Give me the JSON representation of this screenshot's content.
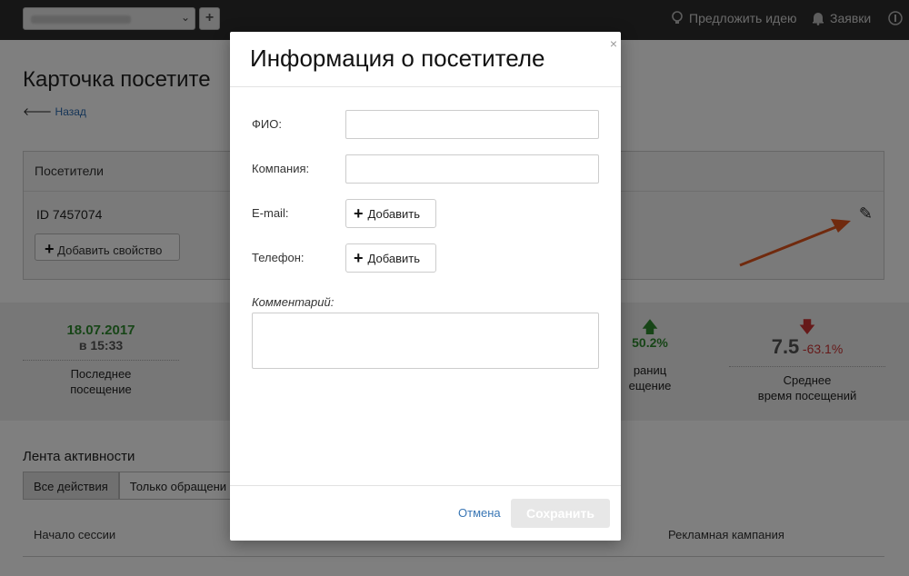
{
  "topbar": {
    "nav_idea": "Предложить идею",
    "nav_requests": "Заявки",
    "add_symbol": "+",
    "chevron": "⌄"
  },
  "page": {
    "title": "Карточка посетите",
    "back_label": "Назад"
  },
  "visitors": {
    "header": "Посетители",
    "id_label": "ID 7457074",
    "add_property_label": "Добавить свойство"
  },
  "stats": {
    "last_visit_date": "18.07.2017",
    "last_visit_time": "в 15:33",
    "last_visit_label": "Последнее\nпосещение",
    "pages_change": "50.2%",
    "pages_label_part1": "раниц",
    "pages_label_part2": "ещение",
    "avg_value": "7.5",
    "avg_change": "-63.1%",
    "avg_label": "Среднее\nвремя посещений",
    "colors": {
      "up": "#2e8b2e",
      "down": "#cc3333"
    }
  },
  "feed": {
    "title": "Лента активности",
    "tabs": [
      "Все действия",
      "Только обращени"
    ],
    "columns": {
      "session_start": "Начало сессии",
      "ad_campaign": "Рекламная кампания"
    }
  },
  "modal": {
    "title": "Информация о посетителе",
    "fields": {
      "name_label": "ФИО:",
      "company_label": "Компания:",
      "email_label": "E-mail:",
      "phone_label": "Телефон:"
    },
    "add_label": "Добавить",
    "comment_label": "Комментарий:",
    "cancel_label": "Отмена",
    "save_label": "Сохранить",
    "close_symbol": "×"
  }
}
